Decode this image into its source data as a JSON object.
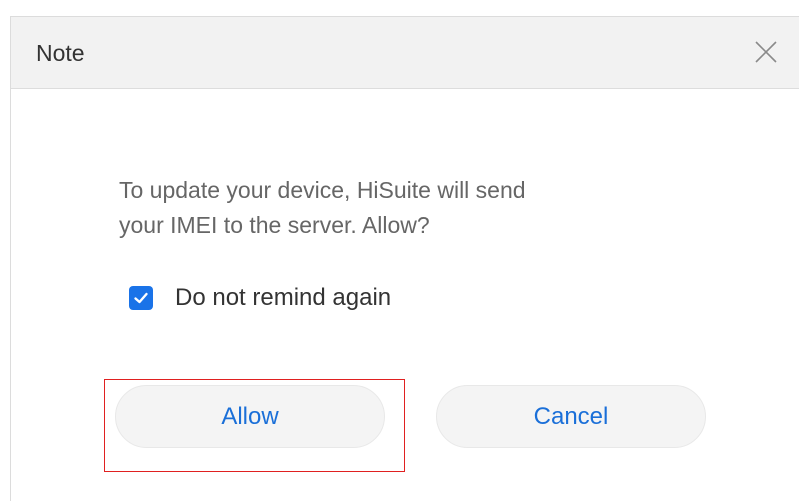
{
  "dialog": {
    "title": "Note",
    "close_icon": "close-icon",
    "message_line1": "To update your device, HiSuite will send",
    "message_line2": "your IMEI to the server. Allow?",
    "checkbox": {
      "label": "Do not remind again",
      "checked": true,
      "icon": "check-icon"
    },
    "buttons": {
      "allow_label": "Allow",
      "cancel_label": "Cancel"
    }
  },
  "colors": {
    "accent": "#1a73e8",
    "button_text": "#1a6fd8",
    "highlight": "#e02020",
    "titlebar_bg": "#f2f2f2"
  }
}
